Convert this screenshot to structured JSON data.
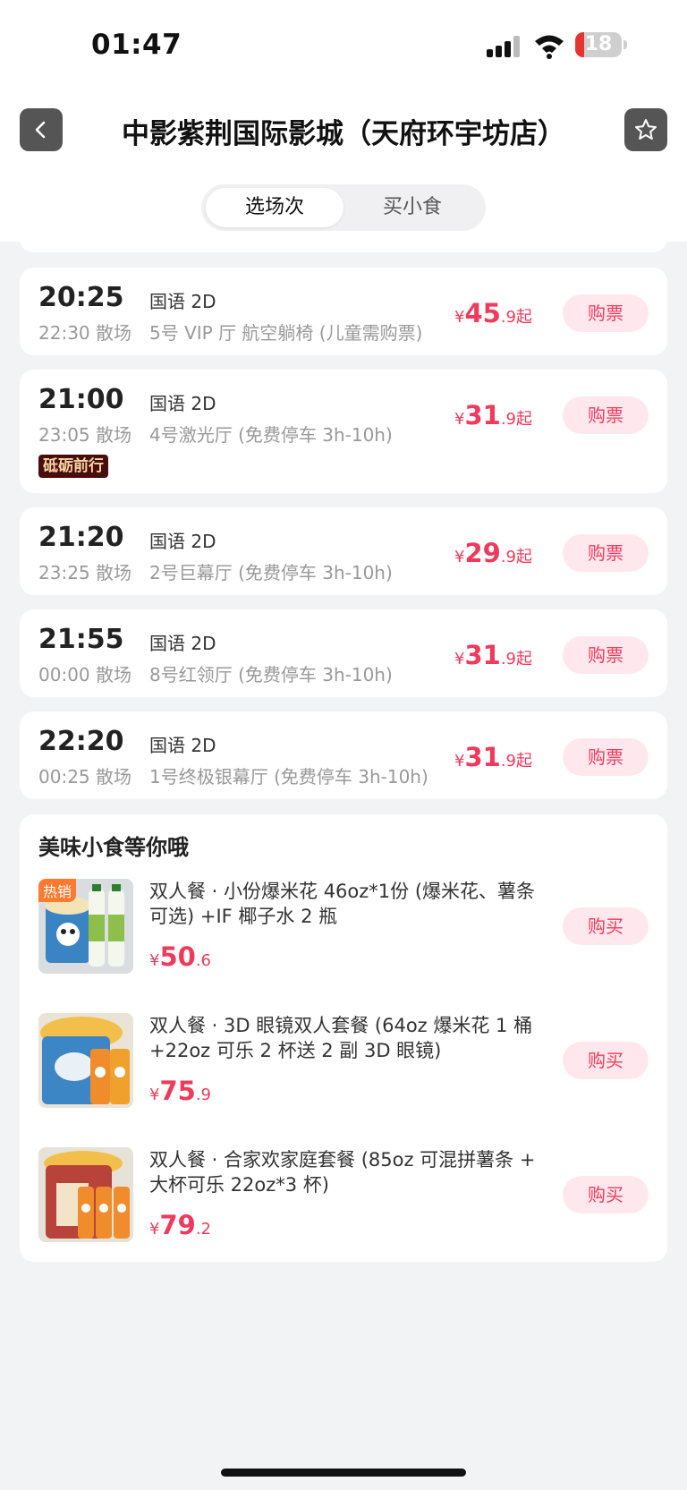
{
  "status_bar": {
    "time": "01:47",
    "battery": "18"
  },
  "header": {
    "title": "中影紫荆国际影城（天府环宇坊店）"
  },
  "tabs": [
    {
      "label": "选场次"
    },
    {
      "label": "买小食"
    }
  ],
  "showtimes": [
    {
      "start": "20:25",
      "lang": "国语 2D",
      "end": "22:30 散场",
      "hall": "5号 VIP 厅  航空躺椅 (儿童需购票)",
      "price_currency": "¥",
      "price_int": "45",
      "price_dec": ".9",
      "price_suffix": "起",
      "button": "购票",
      "tag": ""
    },
    {
      "start": "21:00",
      "lang": "国语 2D",
      "end": "23:05 散场",
      "hall": "4号激光厅 (免费停车 3h-10h)",
      "price_currency": "¥",
      "price_int": "31",
      "price_dec": ".9",
      "price_suffix": "起",
      "button": "购票",
      "tag": "砥砺前行"
    },
    {
      "start": "21:20",
      "lang": "国语 2D",
      "end": "23:25 散场",
      "hall": "2号巨幕厅 (免费停车 3h-10h)",
      "price_currency": "¥",
      "price_int": "29",
      "price_dec": ".9",
      "price_suffix": "起",
      "button": "购票",
      "tag": ""
    },
    {
      "start": "21:55",
      "lang": "国语 2D",
      "end": "00:00 散场",
      "hall": "8号红领厅 (免费停车 3h-10h)",
      "price_currency": "¥",
      "price_int": "31",
      "price_dec": ".9",
      "price_suffix": "起",
      "button": "购票",
      "tag": ""
    },
    {
      "start": "22:20",
      "lang": "国语 2D",
      "end": "00:25 散场",
      "hall": "1号终极银幕厅 (免费停车 3h-10h)",
      "price_currency": "¥",
      "price_int": "31",
      "price_dec": ".9",
      "price_suffix": "起",
      "button": "购票",
      "tag": ""
    }
  ],
  "snacks": {
    "title": "美味小食等你哦",
    "items": [
      {
        "name": "双人餐 · 小份爆米花 46oz*1份 (爆米花、薯条可选) +IF 椰子水 2 瓶",
        "price_currency": "¥",
        "price_int": "50",
        "price_dec": ".6",
        "button": "购买",
        "badge": "热销"
      },
      {
        "name": "双人餐 · 3D 眼镜双人套餐 (64oz 爆米花 1 桶 +22oz 可乐 2 杯送 2 副 3D 眼镜)",
        "price_currency": "¥",
        "price_int": "75",
        "price_dec": ".9",
        "button": "购买",
        "badge": ""
      },
      {
        "name": "双人餐 · 合家欢家庭套餐 (85oz 可混拼薯条 + 大杯可乐 22oz*3 杯)",
        "price_currency": "¥",
        "price_int": "79",
        "price_dec": ".2",
        "button": "购买",
        "badge": ""
      }
    ]
  },
  "colors": {
    "accent": "#ef3a5d",
    "button_bg": "#ffe8ed",
    "background": "#f2f3f5"
  },
  "icons": {
    "back": "chevron-left-icon",
    "favorite": "star-icon"
  }
}
